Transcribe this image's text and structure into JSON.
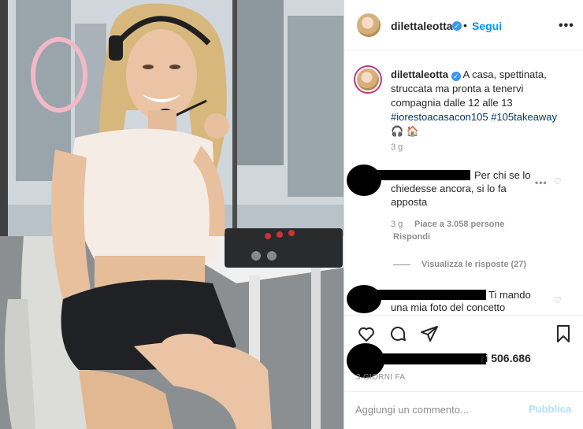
{
  "photo": {
    "alt_subject": "woman with headset at radio desk"
  },
  "post": {
    "username": "dilettaleotta",
    "dot": "•",
    "follow_label": "Segui",
    "more_icon": "more-horizontal-icon"
  },
  "caption": {
    "username": "dilettaleotta",
    "text": "A casa, spettinata, struccata ma pronta a tenervi compagnia dalle 12 alle 13",
    "hashtags": "#iorestoacasacon105 #105takeaway",
    "emoji": "🎧 🏠",
    "time": "3 g"
  },
  "comments": [
    {
      "text_line1": "Per chi se lo",
      "text_line2": "chiedesse ancora, si lo fa",
      "text_line3": "apposta",
      "time": "3 g",
      "likes": "Piace a 3.058 persone",
      "reply": "Rispondi",
      "view_replies": "Visualizza le risposte (27)"
    },
    {
      "text_line1": "Ti mando",
      "text_line2": "una mia foto del concetto"
    }
  ],
  "actions": {
    "like_icon": "heart-icon",
    "comment_icon": "comment-icon",
    "share_icon": "send-icon",
    "save_icon": "bookmark-icon"
  },
  "likes_count": "ri 506.686",
  "days_ago": "3 GIORNI FA",
  "comment_box": {
    "placeholder": "Aggiungi un commento...",
    "publish_label": "Pubblica"
  },
  "colors": {
    "accent": "#0095f6",
    "publish_disabled": "#b2dffc",
    "hashtag": "#00376b",
    "muted": "#8e8e8e"
  }
}
